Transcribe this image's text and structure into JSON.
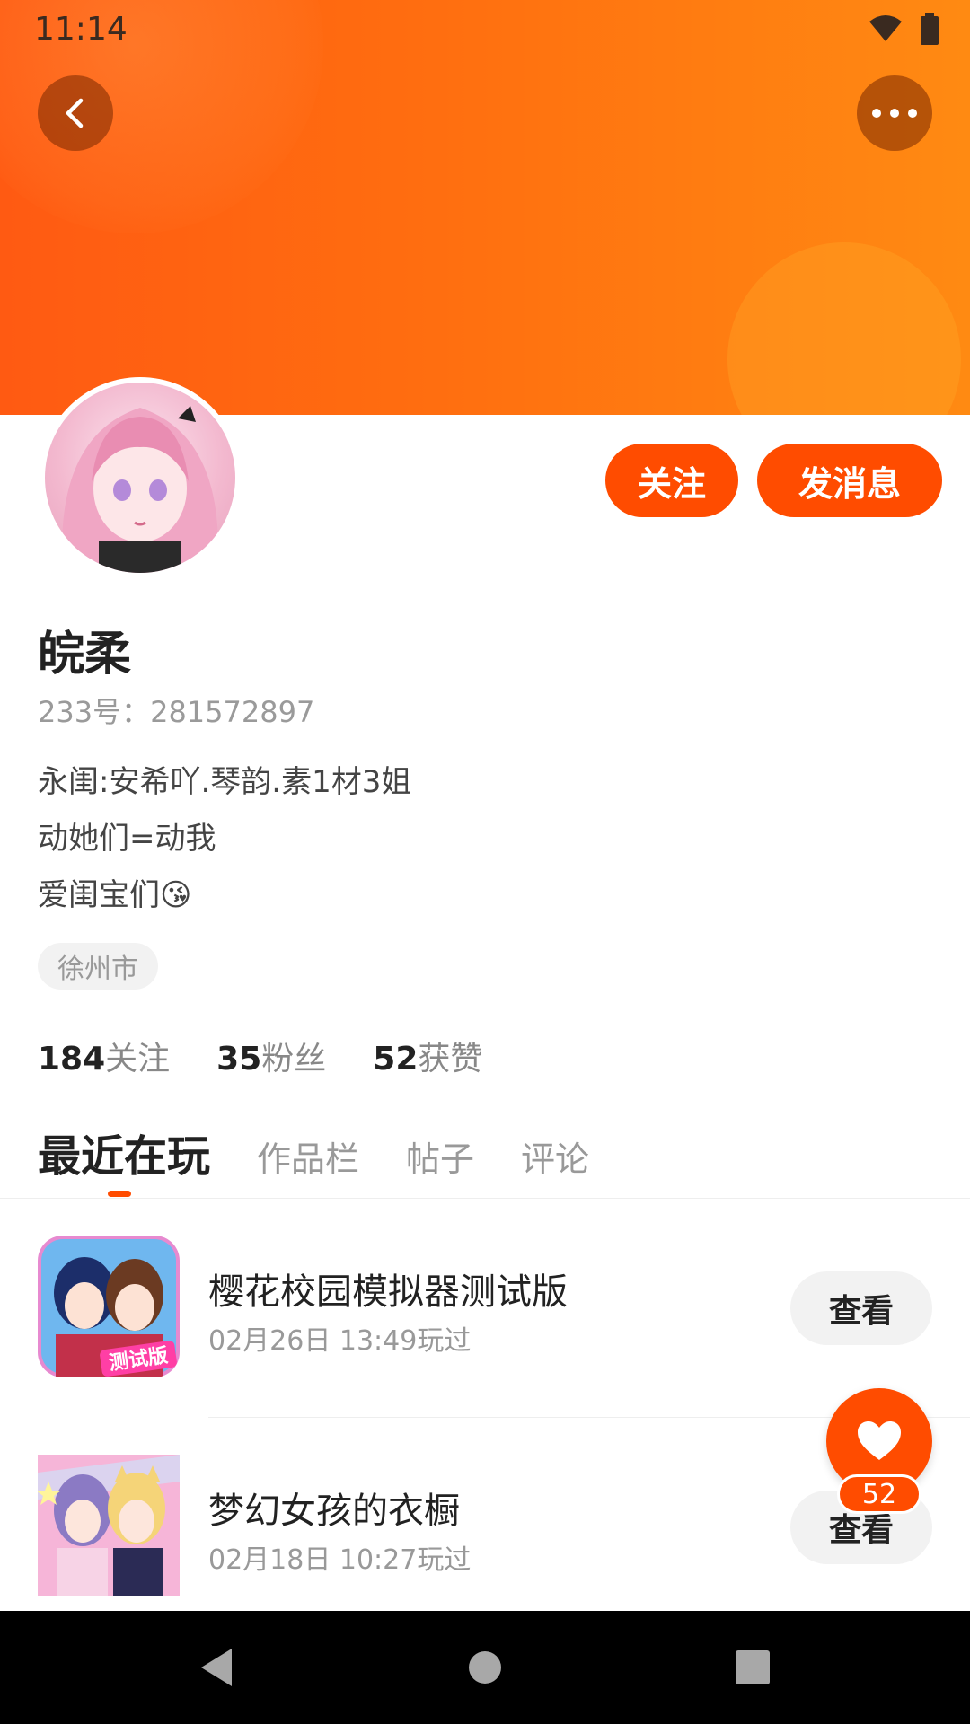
{
  "status_bar": {
    "time": "11:14"
  },
  "profile": {
    "name": "皖柔",
    "uid_label": "233号：281572897",
    "bio_lines": [
      "永闺:安希吖.琴韵.素1材3姐",
      "动她们=动我",
      "爱闺宝们😘"
    ],
    "location": "徐州市",
    "follow_button": "关注",
    "message_button": "发消息"
  },
  "stats": [
    {
      "value": "184",
      "label": "关注"
    },
    {
      "value": "35",
      "label": "粉丝"
    },
    {
      "value": "52",
      "label": "获赞"
    }
  ],
  "tabs": [
    "最近在玩",
    "作品栏",
    "帖子",
    "评论"
  ],
  "games": [
    {
      "title": "樱花校园模拟器测试版",
      "time": "02月26日 13:49玩过",
      "action": "查看",
      "icon_badge": "测试版"
    },
    {
      "title": "梦幻女孩的衣橱",
      "time": "02月18日 10:27玩过",
      "action": "查看"
    }
  ],
  "like": {
    "count": "52"
  },
  "colors": {
    "accent": "#ff4c00",
    "banner": "#ff6e10"
  },
  "icons": {
    "back": "chevron-left-icon",
    "more": "more-dots-icon",
    "like": "heart-icon",
    "wifi": "wifi-icon",
    "battery": "battery-icon"
  }
}
